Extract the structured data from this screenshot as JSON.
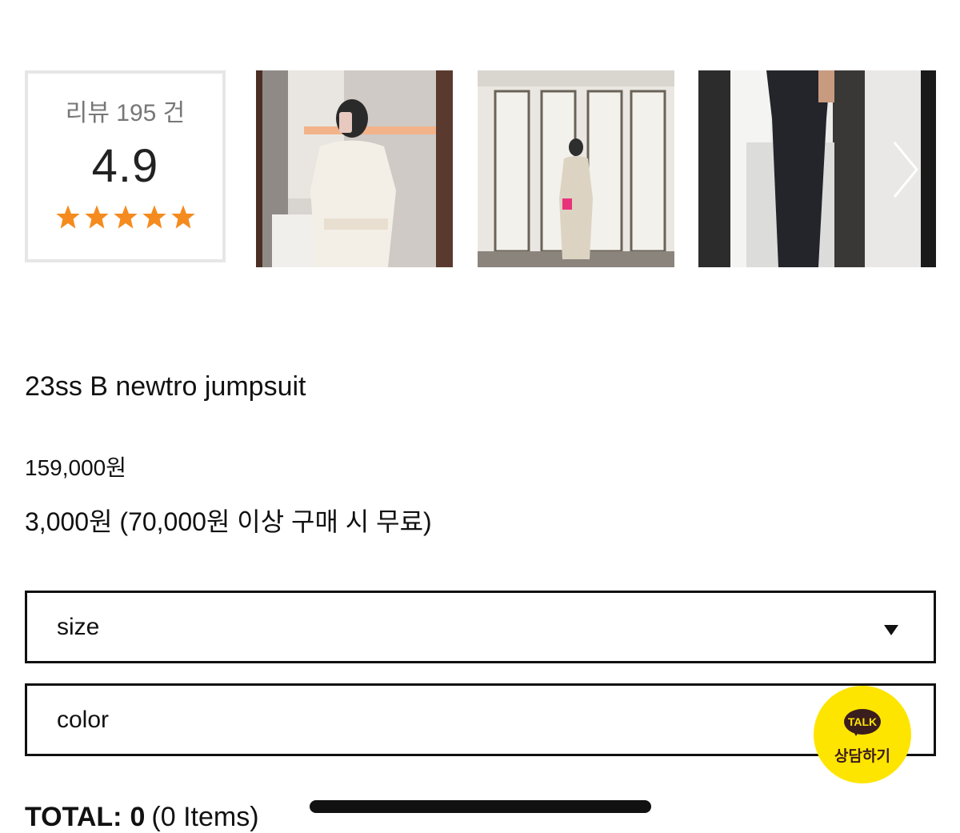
{
  "review": {
    "count_label": "리뷰 195 건",
    "score": "4.9",
    "stars": 5,
    "star_color": "#f58b1f"
  },
  "gallery": {
    "images": [
      "review-photo-white-jumpsuit",
      "review-photo-beige-jumpsuit",
      "review-photo-black-jumpsuit"
    ],
    "next_icon": "chevron-right-icon"
  },
  "product": {
    "name": "23ss B newtro jumpsuit",
    "price": "159,000원",
    "shipping": "3,000원 (70,000원 이상 구매 시 무료)"
  },
  "options": {
    "size_label": "size",
    "color_label": "color"
  },
  "talk_button": {
    "bubble": "TALK",
    "label": "상담하기",
    "color": "#fee500"
  },
  "total": {
    "label": "TOTAL:",
    "value": "0",
    "items": "(0 Items)"
  }
}
